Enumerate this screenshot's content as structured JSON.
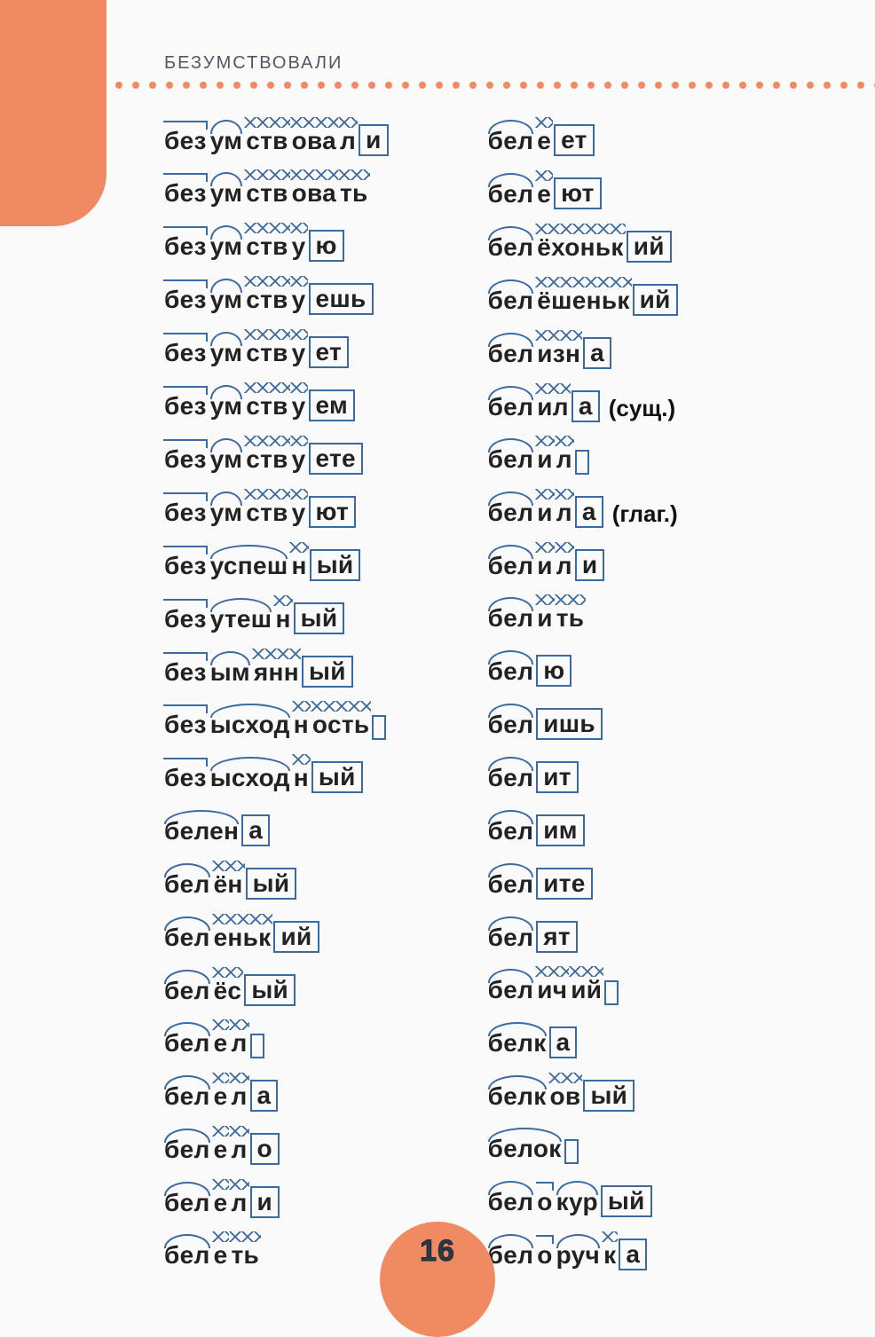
{
  "header": {
    "title": "БЕЗУМСТВОВАЛИ"
  },
  "page": {
    "number": "16"
  },
  "columns": [
    [
      {
        "segments": [
          {
            "type": "prefix",
            "text": "без"
          },
          {
            "type": "root",
            "text": "ум"
          },
          {
            "type": "suffix",
            "text": "ств"
          },
          {
            "type": "suffix",
            "text": "ова"
          },
          {
            "type": "suffix",
            "text": "л"
          },
          {
            "type": "ending",
            "text": "и"
          }
        ]
      },
      {
        "segments": [
          {
            "type": "prefix",
            "text": "без"
          },
          {
            "type": "root",
            "text": "ум"
          },
          {
            "type": "suffix",
            "text": "ств"
          },
          {
            "type": "suffix",
            "text": "ова"
          },
          {
            "type": "suffix",
            "text": "ть"
          }
        ]
      },
      {
        "segments": [
          {
            "type": "prefix",
            "text": "без"
          },
          {
            "type": "root",
            "text": "ум"
          },
          {
            "type": "suffix",
            "text": "ств"
          },
          {
            "type": "suffix",
            "text": "у"
          },
          {
            "type": "ending",
            "text": "ю"
          }
        ]
      },
      {
        "segments": [
          {
            "type": "prefix",
            "text": "без"
          },
          {
            "type": "root",
            "text": "ум"
          },
          {
            "type": "suffix",
            "text": "ств"
          },
          {
            "type": "suffix",
            "text": "у"
          },
          {
            "type": "ending",
            "text": "ешь"
          }
        ]
      },
      {
        "segments": [
          {
            "type": "prefix",
            "text": "без"
          },
          {
            "type": "root",
            "text": "ум"
          },
          {
            "type": "suffix",
            "text": "ств"
          },
          {
            "type": "suffix",
            "text": "у"
          },
          {
            "type": "ending",
            "text": "ет"
          }
        ]
      },
      {
        "segments": [
          {
            "type": "prefix",
            "text": "без"
          },
          {
            "type": "root",
            "text": "ум"
          },
          {
            "type": "suffix",
            "text": "ств"
          },
          {
            "type": "suffix",
            "text": "у"
          },
          {
            "type": "ending",
            "text": "ем"
          }
        ]
      },
      {
        "segments": [
          {
            "type": "prefix",
            "text": "без"
          },
          {
            "type": "root",
            "text": "ум"
          },
          {
            "type": "suffix",
            "text": "ств"
          },
          {
            "type": "suffix",
            "text": "у"
          },
          {
            "type": "ending",
            "text": "ете"
          }
        ]
      },
      {
        "segments": [
          {
            "type": "prefix",
            "text": "без"
          },
          {
            "type": "root",
            "text": "ум"
          },
          {
            "type": "suffix",
            "text": "ств"
          },
          {
            "type": "suffix",
            "text": "у"
          },
          {
            "type": "ending",
            "text": "ют"
          }
        ]
      },
      {
        "segments": [
          {
            "type": "prefix",
            "text": "без"
          },
          {
            "type": "root",
            "text": "успеш"
          },
          {
            "type": "suffix",
            "text": "н"
          },
          {
            "type": "ending",
            "text": "ый"
          }
        ]
      },
      {
        "segments": [
          {
            "type": "prefix",
            "text": "без"
          },
          {
            "type": "root",
            "text": "утеш"
          },
          {
            "type": "suffix",
            "text": "н"
          },
          {
            "type": "ending",
            "text": "ый"
          }
        ]
      },
      {
        "segments": [
          {
            "type": "prefix",
            "text": "без"
          },
          {
            "type": "root",
            "text": "ым"
          },
          {
            "type": "suffix",
            "text": "янн"
          },
          {
            "type": "ending",
            "text": "ый"
          }
        ]
      },
      {
        "segments": [
          {
            "type": "prefix",
            "text": "без"
          },
          {
            "type": "root",
            "text": "ысход"
          },
          {
            "type": "suffix",
            "text": "н"
          },
          {
            "type": "suffix",
            "text": "ость"
          },
          {
            "type": "ending",
            "text": ""
          }
        ]
      },
      {
        "segments": [
          {
            "type": "prefix",
            "text": "без"
          },
          {
            "type": "root",
            "text": "ысход"
          },
          {
            "type": "suffix",
            "text": "н"
          },
          {
            "type": "ending",
            "text": "ый"
          }
        ]
      },
      {
        "segments": [
          {
            "type": "root",
            "text": "белен"
          },
          {
            "type": "ending",
            "text": "а"
          }
        ]
      },
      {
        "segments": [
          {
            "type": "root",
            "text": "бел"
          },
          {
            "type": "suffix",
            "text": "ён"
          },
          {
            "type": "ending",
            "text": "ый"
          }
        ]
      },
      {
        "segments": [
          {
            "type": "root",
            "text": "бел"
          },
          {
            "type": "suffix",
            "text": "еньк"
          },
          {
            "type": "ending",
            "text": "ий"
          }
        ]
      },
      {
        "segments": [
          {
            "type": "root",
            "text": "бел"
          },
          {
            "type": "suffix",
            "text": "ёс"
          },
          {
            "type": "ending",
            "text": "ый"
          }
        ]
      },
      {
        "segments": [
          {
            "type": "root",
            "text": "бел"
          },
          {
            "type": "suffix",
            "text": "е"
          },
          {
            "type": "suffix",
            "text": "л"
          },
          {
            "type": "ending",
            "text": ""
          }
        ]
      },
      {
        "segments": [
          {
            "type": "root",
            "text": "бел"
          },
          {
            "type": "suffix",
            "text": "е"
          },
          {
            "type": "suffix",
            "text": "л"
          },
          {
            "type": "ending",
            "text": "а"
          }
        ]
      },
      {
        "segments": [
          {
            "type": "root",
            "text": "бел"
          },
          {
            "type": "suffix",
            "text": "е"
          },
          {
            "type": "suffix",
            "text": "л"
          },
          {
            "type": "ending",
            "text": "о"
          }
        ]
      },
      {
        "segments": [
          {
            "type": "root",
            "text": "бел"
          },
          {
            "type": "suffix",
            "text": "е"
          },
          {
            "type": "suffix",
            "text": "л"
          },
          {
            "type": "ending",
            "text": "и"
          }
        ]
      },
      {
        "segments": [
          {
            "type": "root",
            "text": "бел"
          },
          {
            "type": "suffix",
            "text": "е"
          },
          {
            "type": "suffix",
            "text": "ть"
          }
        ]
      }
    ],
    [
      {
        "segments": [
          {
            "type": "root",
            "text": "бел"
          },
          {
            "type": "suffix",
            "text": "е"
          },
          {
            "type": "ending",
            "text": "ет"
          }
        ]
      },
      {
        "segments": [
          {
            "type": "root",
            "text": "бел"
          },
          {
            "type": "suffix",
            "text": "е"
          },
          {
            "type": "ending",
            "text": "ют"
          }
        ]
      },
      {
        "segments": [
          {
            "type": "root",
            "text": "бел"
          },
          {
            "type": "suffix",
            "text": "ёхоньк"
          },
          {
            "type": "ending",
            "text": "ий"
          }
        ]
      },
      {
        "segments": [
          {
            "type": "root",
            "text": "бел"
          },
          {
            "type": "suffix",
            "text": "ёшеньк"
          },
          {
            "type": "ending",
            "text": "ий"
          }
        ]
      },
      {
        "segments": [
          {
            "type": "root",
            "text": "бел"
          },
          {
            "type": "suffix",
            "text": "изн"
          },
          {
            "type": "ending",
            "text": "а"
          }
        ]
      },
      {
        "segments": [
          {
            "type": "root",
            "text": "бел"
          },
          {
            "type": "suffix",
            "text": "ил"
          },
          {
            "type": "ending",
            "text": "а"
          }
        ],
        "annotation": "(сущ.)"
      },
      {
        "segments": [
          {
            "type": "root",
            "text": "бел"
          },
          {
            "type": "suffix",
            "text": "и"
          },
          {
            "type": "suffix",
            "text": "л"
          },
          {
            "type": "ending",
            "text": ""
          }
        ]
      },
      {
        "segments": [
          {
            "type": "root",
            "text": "бел"
          },
          {
            "type": "suffix",
            "text": "и"
          },
          {
            "type": "suffix",
            "text": "л"
          },
          {
            "type": "ending",
            "text": "а"
          }
        ],
        "annotation": "(глаг.)"
      },
      {
        "segments": [
          {
            "type": "root",
            "text": "бел"
          },
          {
            "type": "suffix",
            "text": "и"
          },
          {
            "type": "suffix",
            "text": "л"
          },
          {
            "type": "ending",
            "text": "и"
          }
        ]
      },
      {
        "segments": [
          {
            "type": "root",
            "text": "бел"
          },
          {
            "type": "suffix",
            "text": "и"
          },
          {
            "type": "suffix",
            "text": "ть"
          }
        ]
      },
      {
        "segments": [
          {
            "type": "root",
            "text": "бел"
          },
          {
            "type": "ending",
            "text": "ю"
          }
        ]
      },
      {
        "segments": [
          {
            "type": "root",
            "text": "бел"
          },
          {
            "type": "ending",
            "text": "ишь"
          }
        ]
      },
      {
        "segments": [
          {
            "type": "root",
            "text": "бел"
          },
          {
            "type": "ending",
            "text": "ит"
          }
        ]
      },
      {
        "segments": [
          {
            "type": "root",
            "text": "бел"
          },
          {
            "type": "ending",
            "text": "им"
          }
        ]
      },
      {
        "segments": [
          {
            "type": "root",
            "text": "бел"
          },
          {
            "type": "ending",
            "text": "ите"
          }
        ]
      },
      {
        "segments": [
          {
            "type": "root",
            "text": "бел"
          },
          {
            "type": "ending",
            "text": "ят"
          }
        ]
      },
      {
        "segments": [
          {
            "type": "root",
            "text": "бел"
          },
          {
            "type": "suffix",
            "text": "ич"
          },
          {
            "type": "suffix",
            "text": "ий"
          },
          {
            "type": "ending",
            "text": ""
          }
        ]
      },
      {
        "segments": [
          {
            "type": "root",
            "text": "белк"
          },
          {
            "type": "ending",
            "text": "а"
          }
        ]
      },
      {
        "segments": [
          {
            "type": "root",
            "text": "белк"
          },
          {
            "type": "suffix",
            "text": "ов"
          },
          {
            "type": "ending",
            "text": "ый"
          }
        ]
      },
      {
        "segments": [
          {
            "type": "root",
            "text": "белок"
          },
          {
            "type": "ending",
            "text": ""
          }
        ]
      },
      {
        "segments": [
          {
            "type": "root",
            "text": "бел"
          },
          {
            "type": "prefix",
            "text": "о"
          },
          {
            "type": "root",
            "text": "кур"
          },
          {
            "type": "ending",
            "text": "ый"
          }
        ]
      },
      {
        "segments": [
          {
            "type": "root",
            "text": "бел"
          },
          {
            "type": "prefix",
            "text": "о"
          },
          {
            "type": "root",
            "text": "руч"
          },
          {
            "type": "suffix",
            "text": "к"
          },
          {
            "type": "ending",
            "text": "а"
          }
        ]
      }
    ]
  ]
}
